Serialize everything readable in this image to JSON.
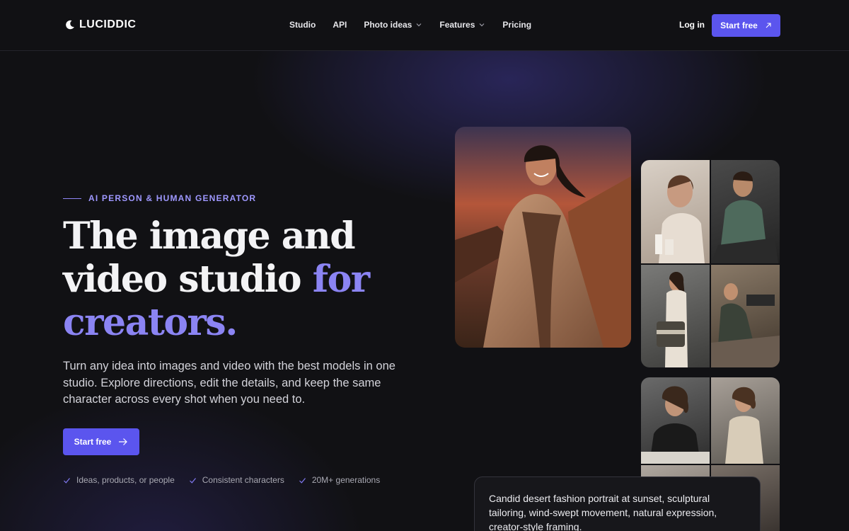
{
  "brand": {
    "name": "LUCIDDIC",
    "accent_color": "#5b55ee",
    "accent_text_color": "#8b84f3"
  },
  "nav": {
    "items": [
      {
        "label": "Studio",
        "has_dropdown": false
      },
      {
        "label": "API",
        "has_dropdown": false
      },
      {
        "label": "Photo ideas",
        "has_dropdown": true
      },
      {
        "label": "Features",
        "has_dropdown": true
      },
      {
        "label": "Pricing",
        "has_dropdown": false
      }
    ],
    "login_label": "Log in",
    "cta_label": "Start free",
    "cta_icon": "arrow-up-right-icon"
  },
  "hero": {
    "eyebrow": "AI PERSON & HUMAN GENERATOR",
    "headline_part1": "The image and video studio ",
    "headline_accent": "for creators.",
    "subtitle": "Turn any idea into images and video with the best models in one studio. Explore directions, edit the details, and keep the same character across every shot when you need to.",
    "cta_label": "Start free",
    "cta_icon": "arrow-right-icon",
    "checks": [
      "Ideas, products, or people",
      "Consistent characters",
      "20M+ generations"
    ]
  },
  "gallery": {
    "prompt_text": "Candid desert fashion portrait at sunset, sculptural tailoring, wind-swept movement, natural expression, creator-style framing."
  }
}
